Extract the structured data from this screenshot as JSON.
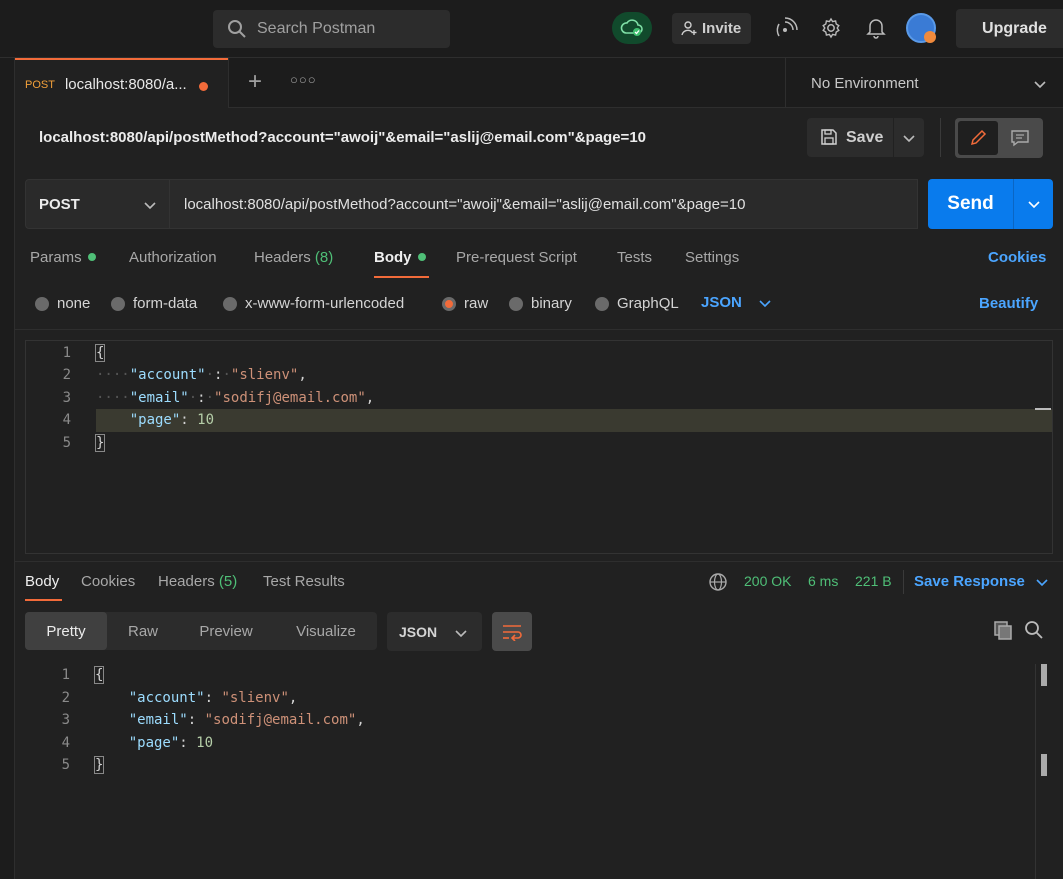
{
  "topbar": {
    "search_placeholder": "Search Postman",
    "invite_label": "Invite",
    "upgrade_label": "Upgrade"
  },
  "tabs": [
    {
      "method": "POST",
      "title": "localhost:8080/a...",
      "unsaved": true
    }
  ],
  "environment": {
    "selected": "No Environment"
  },
  "request": {
    "title": "localhost:8080/api/postMethod?account=\"awoij\"&email=\"aslij@email.com\"&page=10",
    "save_label": "Save",
    "method": "POST",
    "url": "localhost:8080/api/postMethod?account=\"awoij\"&email=\"aslij@email.com\"&page=10",
    "send_label": "Send",
    "tabs": {
      "params": "Params",
      "authorization": "Authorization",
      "headers": "Headers",
      "headers_count": "(8)",
      "body": "Body",
      "prerequest": "Pre-request Script",
      "tests": "Tests",
      "settings": "Settings",
      "cookies": "Cookies"
    },
    "body_types": {
      "none": "none",
      "form_data": "form-data",
      "urlencoded": "x-www-form-urlencoded",
      "raw": "raw",
      "binary": "binary",
      "graphql": "GraphQL",
      "format": "JSON",
      "beautify": "Beautify"
    },
    "line_numbers": [
      "1",
      "2",
      "3",
      "4",
      "5"
    ],
    "body_lines": {
      "open": "{",
      "k1": "\"account\"",
      "v1": "\"slienv\"",
      "k2": "\"email\"",
      "v2": "\"sodifj@email.com\"",
      "k3": "\"page\"",
      "v3": "10",
      "close": "}"
    }
  },
  "response": {
    "tabs": {
      "body": "Body",
      "cookies": "Cookies",
      "headers": "Headers",
      "headers_count": "(5)",
      "test_results": "Test Results"
    },
    "status": "200 OK",
    "time": "6 ms",
    "size": "221 B",
    "save_response": "Save Response",
    "views": {
      "pretty": "Pretty",
      "raw": "Raw",
      "preview": "Preview",
      "visualize": "Visualize"
    },
    "format": "JSON",
    "line_numbers": [
      "1",
      "2",
      "3",
      "4",
      "5"
    ],
    "body_lines": {
      "open": "{",
      "k1": "\"account\"",
      "v1": "\"slienv\"",
      "k2": "\"email\"",
      "v2": "\"sodifj@email.com\"",
      "k3": "\"page\"",
      "v3": "10",
      "close": "}"
    }
  },
  "colors": {
    "accent_orange": "#f26b3a",
    "send_blue": "#097bed",
    "link_blue": "#4ba5ff",
    "success_green": "#4fbf77"
  }
}
